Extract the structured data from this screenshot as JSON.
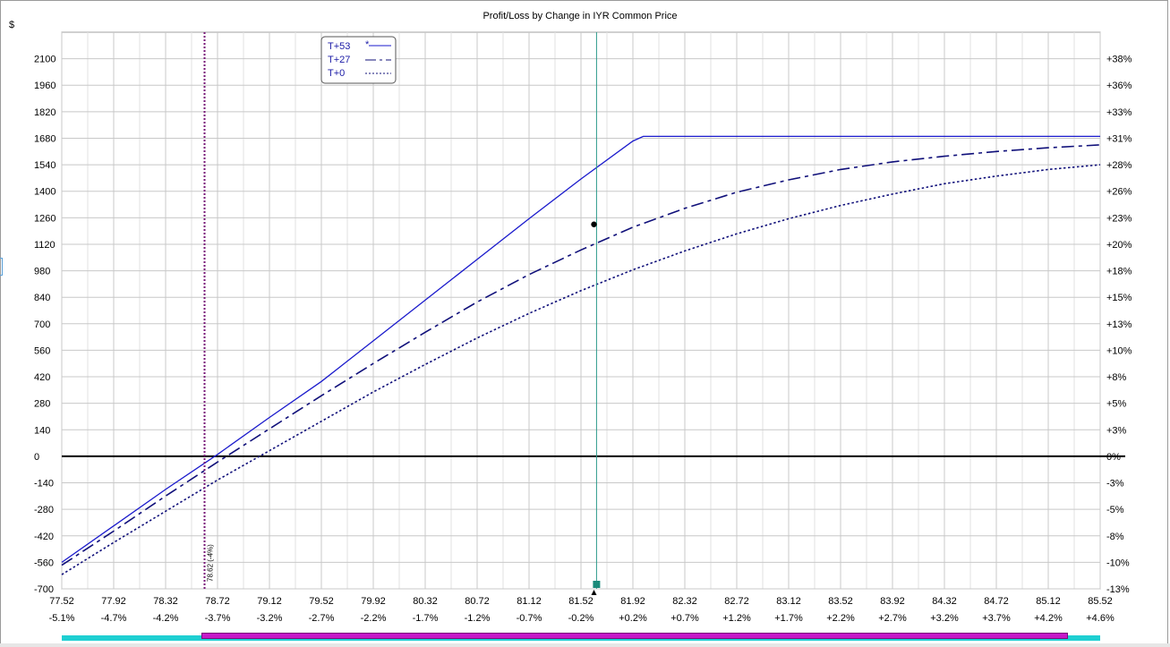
{
  "chart_data": {
    "type": "line",
    "title": "Profit/Loss by Change in IYR Common Price",
    "ylabel": "$",
    "xlim": [
      77.52,
      85.52
    ],
    "ylim": [
      -700,
      2240
    ],
    "x_ticks": [
      "77.52",
      "77.92",
      "78.32",
      "78.72",
      "79.12",
      "79.52",
      "79.92",
      "80.32",
      "80.72",
      "81.12",
      "81.52",
      "81.92",
      "82.32",
      "82.72",
      "83.12",
      "83.52",
      "83.92",
      "84.32",
      "84.72",
      "85.12",
      "85.52"
    ],
    "x_pct_ticks": [
      "-5.1%",
      "-4.7%",
      "-4.2%",
      "-3.7%",
      "-3.2%",
      "-2.7%",
      "-2.2%",
      "-1.7%",
      "-1.2%",
      "-0.7%",
      "-0.2%",
      "+0.2%",
      "+0.7%",
      "+1.2%",
      "+1.7%",
      "+2.2%",
      "+2.7%",
      "+3.2%",
      "+3.7%",
      "+4.2%",
      "+4.6%"
    ],
    "y_ticks": [
      2100,
      1960,
      1820,
      1680,
      1540,
      1400,
      1260,
      1120,
      980,
      840,
      700,
      560,
      420,
      280,
      140,
      0,
      -140,
      -280,
      -420,
      -560,
      -700
    ],
    "y_pct_ticks": [
      "+38%",
      "+36%",
      "+33%",
      "+31%",
      "+28%",
      "+26%",
      "+23%",
      "+20%",
      "+18%",
      "+15%",
      "+13%",
      "+10%",
      "+8%",
      "+5%",
      "+3%",
      "0%",
      "-3%",
      "-5%",
      "-8%",
      "-10%",
      "-13%"
    ],
    "grid": true,
    "legend_position": "top-left",
    "series": [
      {
        "name": "T+53",
        "style": "solid",
        "color": "#1a1acc",
        "x": [
          77.52,
          78.32,
          78.72,
          79.12,
          79.52,
          79.92,
          80.32,
          80.72,
          81.12,
          81.52,
          81.92,
          82.0,
          82.72,
          83.52,
          84.32,
          85.12,
          85.52
        ],
        "y": [
          -560,
          -175,
          10,
          205,
          395,
          610,
          825,
          1040,
          1255,
          1465,
          1665,
          1690,
          1690,
          1690,
          1690,
          1690,
          1690
        ]
      },
      {
        "name": "T+27",
        "style": "dashed",
        "color": "#10107a",
        "x": [
          77.52,
          77.92,
          78.32,
          78.72,
          79.12,
          79.52,
          79.92,
          80.32,
          80.72,
          81.12,
          81.52,
          81.92,
          82.32,
          82.72,
          83.12,
          83.52,
          83.92,
          84.32,
          84.72,
          85.12,
          85.52
        ],
        "y": [
          -575,
          -395,
          -210,
          -30,
          145,
          320,
          490,
          655,
          815,
          960,
          1090,
          1210,
          1310,
          1395,
          1460,
          1515,
          1555,
          1585,
          1610,
          1630,
          1645
        ]
      },
      {
        "name": "T+0",
        "style": "dotted",
        "color": "#10107a",
        "x": [
          77.52,
          77.92,
          78.32,
          78.72,
          79.12,
          79.52,
          79.92,
          80.32,
          80.72,
          81.12,
          81.52,
          81.92,
          82.32,
          82.72,
          83.12,
          83.52,
          83.92,
          84.32,
          84.72,
          85.12,
          85.52
        ],
        "y": [
          -625,
          -455,
          -290,
          -125,
          30,
          185,
          340,
          485,
          625,
          755,
          875,
          985,
          1085,
          1175,
          1255,
          1325,
          1385,
          1440,
          1480,
          1515,
          1540
        ]
      }
    ],
    "annotations": {
      "breakeven_x": 78.62,
      "breakeven_label": "78.62 (-4%)",
      "current_price_x": 81.64,
      "position_point": {
        "x": 81.62,
        "y": 1225
      }
    }
  },
  "legend_markers": {
    "t53": "*"
  },
  "colors": {
    "grid": "#c8c8c8",
    "breakeven_line": "#7a1a7a",
    "current_line": "#2a9a8a",
    "scroll_track": "#1ecfd2",
    "scroll_thumb": "#c619c8"
  }
}
